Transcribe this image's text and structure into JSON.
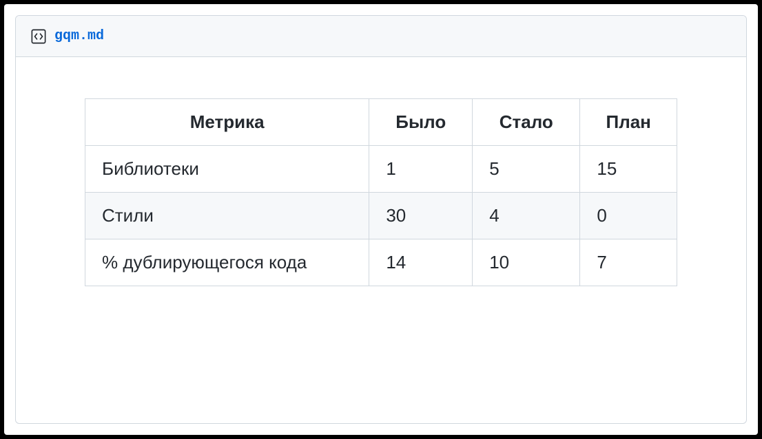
{
  "header": {
    "filename": "gqm.md"
  },
  "chart_data": {
    "type": "table",
    "columns": [
      "Метрика",
      "Было",
      "Стало",
      "План"
    ],
    "rows": [
      {
        "metric": "Библиотеки",
        "was": "1",
        "now": "5",
        "plan": "15"
      },
      {
        "metric": "Стили",
        "was": "30",
        "now": "4",
        "plan": "0"
      },
      {
        "metric": "% дублирующегося кода",
        "was": "14",
        "now": "10",
        "plan": "7"
      }
    ]
  }
}
